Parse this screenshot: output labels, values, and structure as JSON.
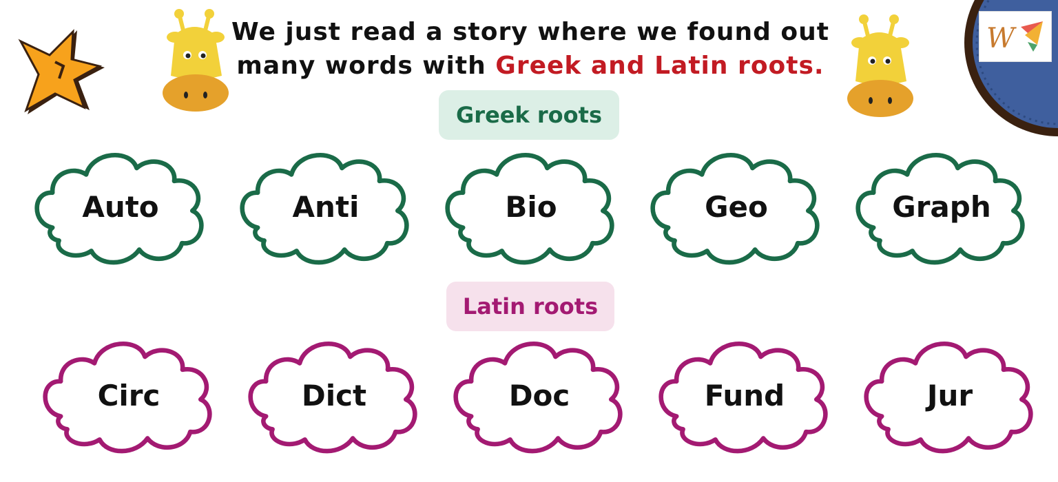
{
  "header": {
    "line1": "We just read a story where we found out",
    "line2_prefix": "many words with ",
    "line2_highlight": "Greek and Latin roots."
  },
  "greek": {
    "label": "Greek roots",
    "color": "#1a6b48",
    "roots": [
      "Auto",
      "Anti",
      "Bio",
      "Geo",
      "Graph"
    ]
  },
  "latin": {
    "label": "Latin roots",
    "color": "#a31a72",
    "roots": [
      "Circ",
      "Dict",
      "Doc",
      "Fund",
      "Jur"
    ]
  },
  "colors": {
    "highlight": "#c21b23",
    "giraffe": "#f2d13a",
    "giraffe_muzzle": "#e5a12b",
    "badge_blue": "#3f5f9e"
  },
  "icons": [
    "star-burst-icon",
    "giraffe-icon",
    "giraffe-icon",
    "logo-icon"
  ]
}
